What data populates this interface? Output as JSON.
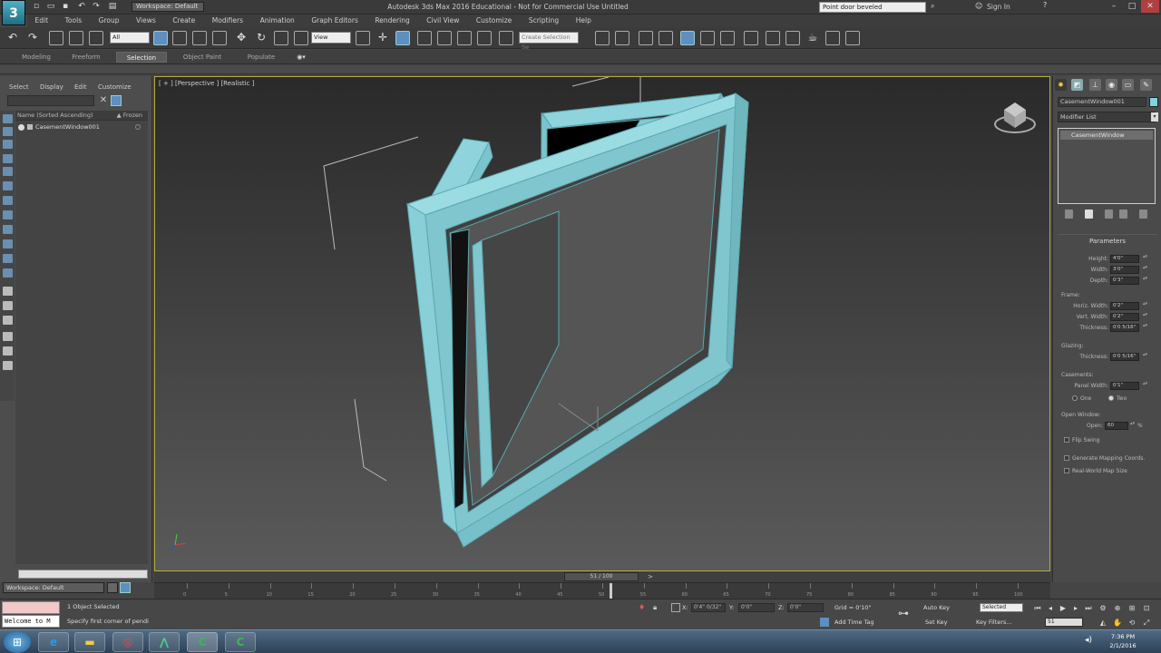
{
  "titlebar": {
    "workspace": "Workspace: Default",
    "title": "Autodesk 3ds Max 2016 Educational - Not for Commercial Use   Untitled",
    "search": "Point door beveled",
    "sign_in": "Sign In"
  },
  "menu": [
    "Edit",
    "Tools",
    "Group",
    "Views",
    "Create",
    "Modifiers",
    "Animation",
    "Graph Editors",
    "Rendering",
    "Civil View",
    "Customize",
    "Scripting",
    "Help"
  ],
  "toolbar": {
    "filter_value": "All",
    "refcoord_value": "View",
    "selset_placeholder": "Create Selection Se"
  },
  "ribbon": {
    "tabs": [
      "Modeling",
      "Freeform",
      "Selection",
      "Object Paint",
      "Populate"
    ],
    "active": "Selection"
  },
  "explorer": {
    "tabs": [
      "Select",
      "Display",
      "Edit",
      "Customize"
    ],
    "column_name": "Name (Sorted Ascending)",
    "column_frozen": "▲ Frozen",
    "objects": [
      "CasementWindow001"
    ]
  },
  "viewport": {
    "label": "[ + ] [Perspective ] [Realistic ]"
  },
  "command_panel": {
    "object_name": "CasementWindow001",
    "modifier_list": "Modifier List",
    "stack_item": "CasementWindow",
    "rollout_title": "Parameters",
    "params": {
      "height_label": "Height:",
      "height": "4'0\"",
      "width_label": "Width:",
      "width": "3'0\"",
      "depth_label": "Depth:",
      "depth": "0'3\"",
      "frame_group": "Frame:",
      "horz_label": "Horiz. Width:",
      "horz": "0'2\"",
      "vert_label": "Vert. Width:",
      "vert": "0'2\"",
      "thick_label": "Thickness:",
      "thick": "0'0 5/16\"",
      "glazing_group": "Glazing:",
      "glaze_thick_label": "Thickness:",
      "glaze_thick": "0'0 5/16\"",
      "casements_group": "Casements:",
      "panel_width_label": "Panel Width:",
      "panel_width": "0'1\"",
      "one_label": "One",
      "two_label": "Two",
      "open_group": "Open Window:",
      "open_label": "Open:",
      "open": "60",
      "open_unit": "%",
      "flip_swing": "Flip Swing",
      "gen_mapping": "Generate Mapping Coords.",
      "real_world": "Real-World Map Size"
    }
  },
  "timeline": {
    "frame_display": "51 / 100",
    "current_frame": 51,
    "ticks": [
      "0",
      "5",
      "10",
      "15",
      "20",
      "25",
      "30",
      "35",
      "40",
      "45",
      "50",
      "55",
      "60",
      "65",
      "70",
      "75",
      "80",
      "85",
      "90",
      "95",
      "100"
    ]
  },
  "status": {
    "workspace": "Workspace: Default",
    "listener_text": "Welcome to M",
    "selected": "1 Object Selected",
    "prompt": "Specify first corner of pendi",
    "x_label": "X:",
    "x": "0'4\" 0/32\"",
    "y_label": "Y:",
    "y": "0'0\"",
    "z_label": "Z:",
    "z": "0'0\"",
    "grid": "Grid = 0'10\"",
    "auto_key": "Auto Key",
    "set_key": "Set Key",
    "selected_dd": "Selected",
    "key_filters": "Key Filters...",
    "add_time_tag": "Add Time Tag",
    "frame": "51"
  },
  "taskbar": {
    "time": "7:36 PM",
    "date": "2/1/2016"
  }
}
